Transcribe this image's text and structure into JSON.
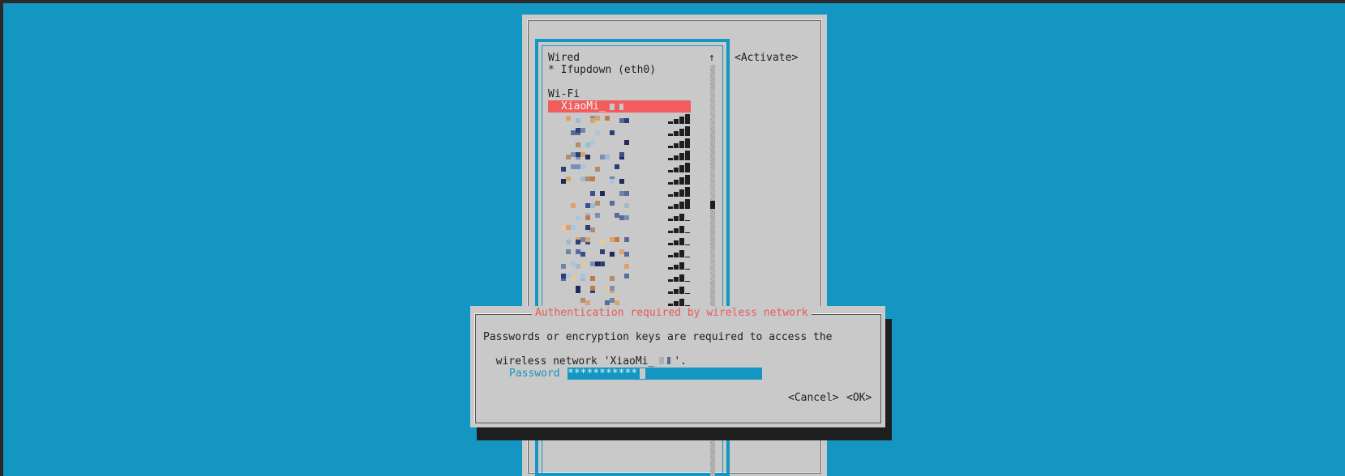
{
  "list": {
    "sections": {
      "wired": "Wired",
      "wifi": "Wi-Fi"
    },
    "wired_items": [
      {
        "label": "* Ifupdown (eth0)"
      }
    ],
    "selected_wifi": "XiaoMi_",
    "wifi_rows": [
      {
        "signal": 4
      },
      {
        "signal": 4
      },
      {
        "signal": 4
      },
      {
        "signal": 4
      },
      {
        "signal": 4
      },
      {
        "signal": 4
      },
      {
        "signal": 4
      },
      {
        "signal": 4
      },
      {
        "signal": 3
      },
      {
        "signal": 3
      },
      {
        "signal": 3
      },
      {
        "signal": 3
      },
      {
        "signal": 3
      },
      {
        "signal": 3
      },
      {
        "signal": 3
      },
      {
        "signal": 3
      },
      {
        "signal": 2
      },
      {
        "signal": 2
      }
    ],
    "scroll_up_glyph": "↑"
  },
  "side_buttons": {
    "activate": "<Activate>"
  },
  "dialog": {
    "title": "Authentication required by wireless network",
    "message_line1": "Passwords or encryption keys are required to access the",
    "message_line2": "wireless network 'XiaoMi_",
    "message_line2_end": "'.",
    "password_label": "Password",
    "password_value": "***********",
    "cancel_label": "<Cancel>",
    "ok_label": "<OK>"
  },
  "colors": {
    "background": "#1396c1",
    "panel": "#c9c9c9",
    "highlight": "#f25c5c",
    "title_red": "#e85a5a",
    "label_cyan": "#1396c1"
  }
}
